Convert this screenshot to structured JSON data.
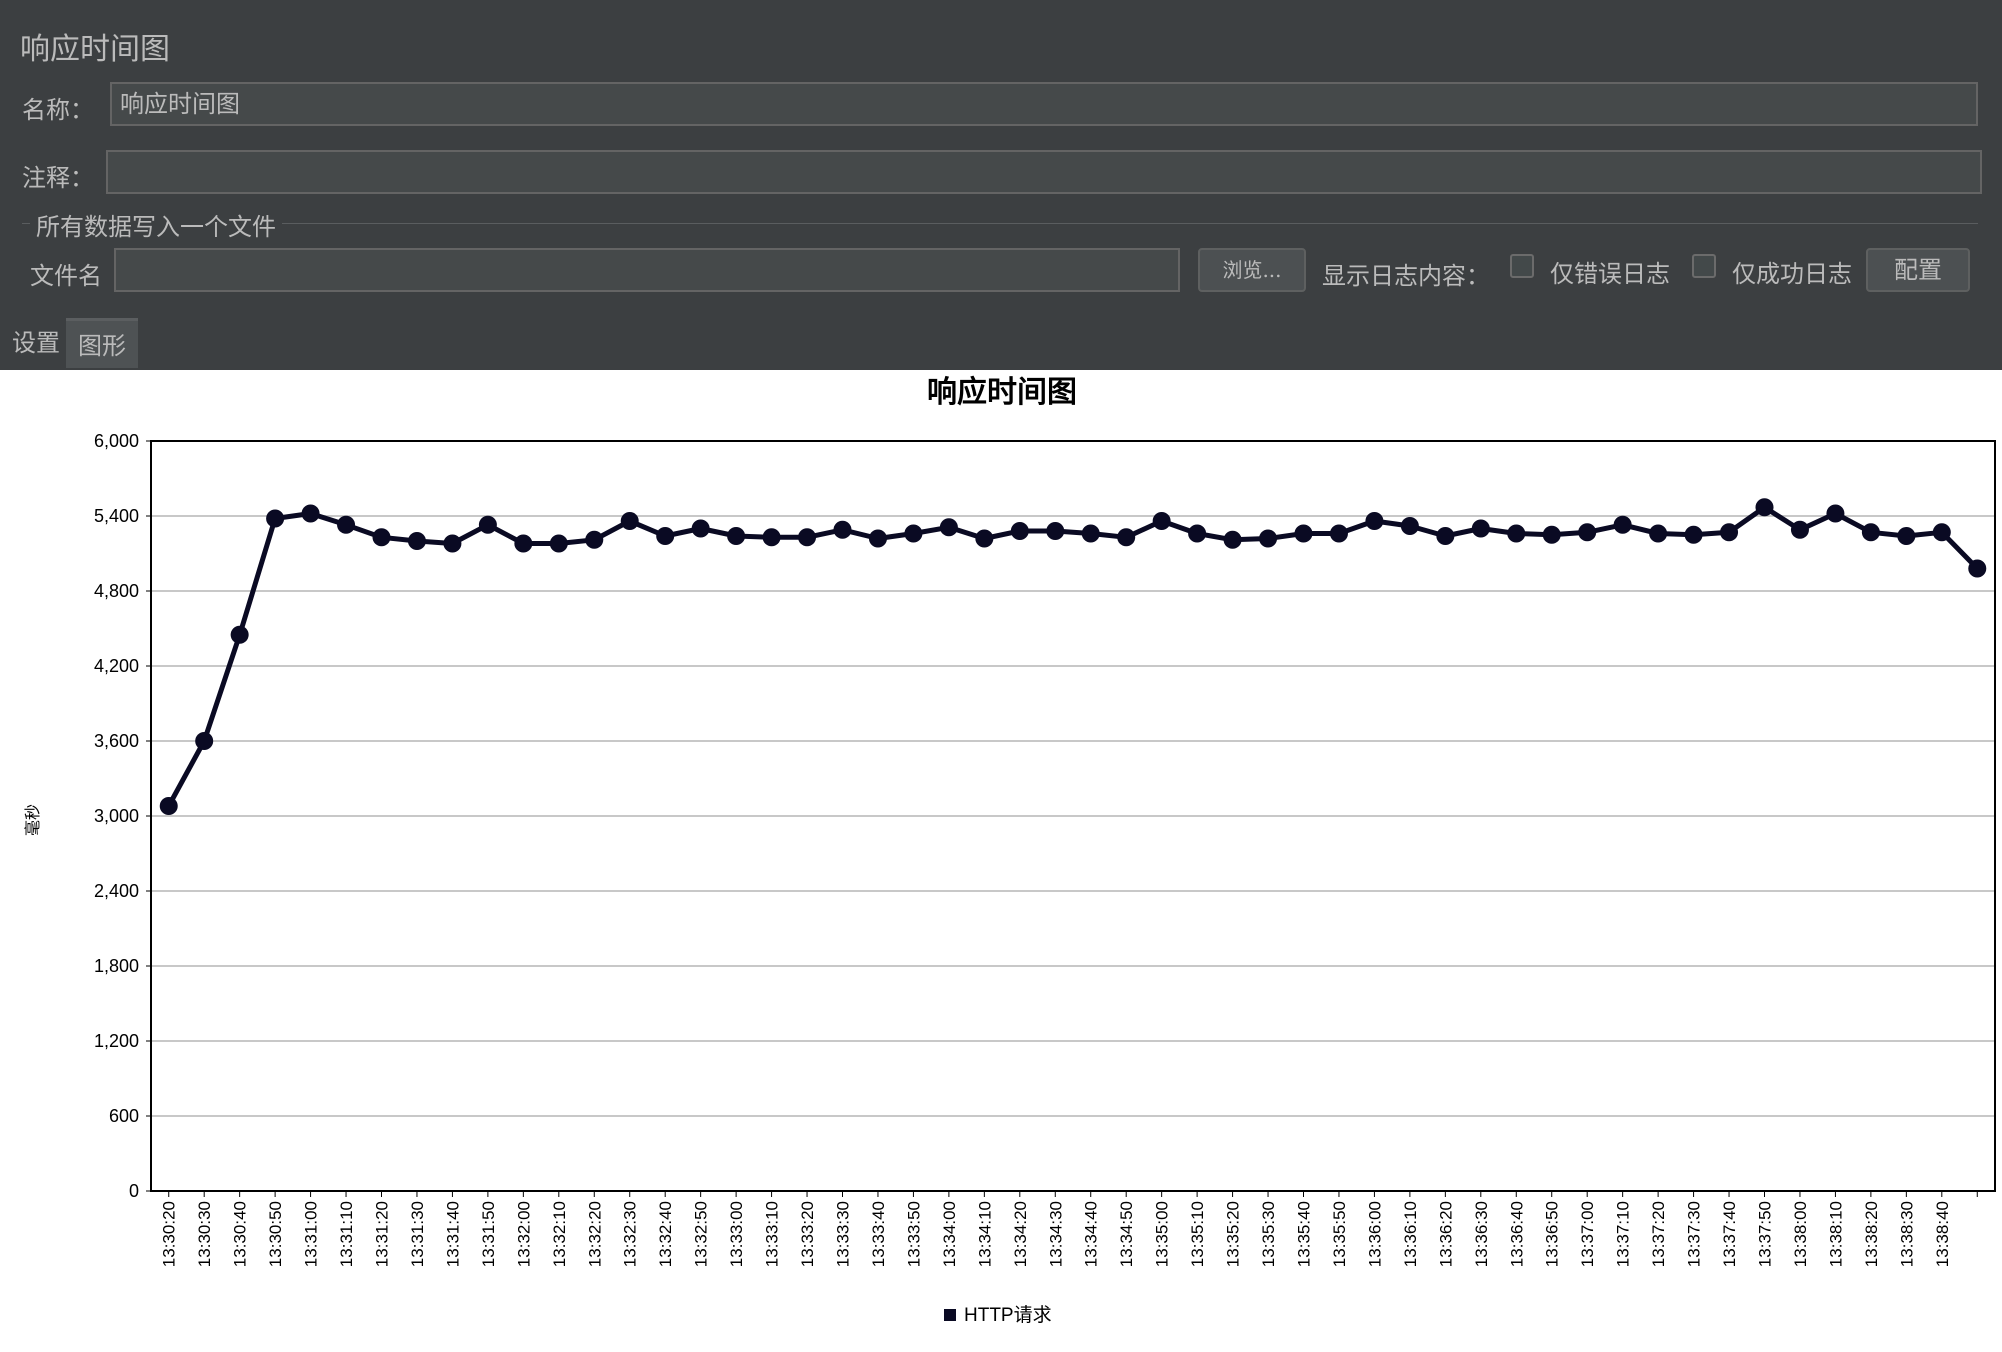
{
  "panel": {
    "title": "响应时间图",
    "name_label": "名称：",
    "name_value": "响应时间图",
    "comment_label": "注释：",
    "comment_value": "",
    "file_section_title": "所有数据写入一个文件",
    "file_label": "文件名",
    "file_value": "",
    "browse_button": "浏览...",
    "log_content_label": "显示日志内容：",
    "errors_only_label": "仅错误日志",
    "success_only_label": "仅成功日志",
    "configure_button": "配置"
  },
  "tabs": [
    {
      "label": "设置",
      "active": false
    },
    {
      "label": "图形",
      "active": true
    }
  ],
  "chart_data": {
    "type": "line",
    "title": "响应时间图",
    "xlabel": "",
    "ylabel": "毫秒",
    "ylim": [
      0,
      6000
    ],
    "yticks": [
      "0",
      "600",
      "1,200",
      "1,800",
      "2,400",
      "3,000",
      "3,600",
      "4,200",
      "4,800",
      "5,400",
      "6,000"
    ],
    "grid": true,
    "legend": "bottom",
    "x": [
      "13:30:20",
      "13:30:30",
      "13:30:40",
      "13:30:50",
      "13:31:00",
      "13:31:10",
      "13:31:20",
      "13:31:30",
      "13:31:40",
      "13:31:50",
      "13:32:00",
      "13:32:10",
      "13:32:20",
      "13:32:30",
      "13:32:40",
      "13:32:50",
      "13:33:00",
      "13:33:10",
      "13:33:20",
      "13:33:30",
      "13:33:40",
      "13:33:50",
      "13:34:00",
      "13:34:10",
      "13:34:20",
      "13:34:30",
      "13:34:40",
      "13:34:50",
      "13:35:00",
      "13:35:10",
      "13:35:20",
      "13:35:30",
      "13:35:40",
      "13:35:50",
      "13:36:00",
      "13:36:10",
      "13:36:20",
      "13:36:30",
      "13:36:40",
      "13:36:50",
      "13:37:00",
      "13:37:10",
      "13:37:20",
      "13:37:30",
      "13:37:40",
      "13:37:50",
      "13:38:00",
      "13:38:10",
      "13:38:20",
      "13:38:30",
      "13:38:40",
      ""
    ],
    "series": [
      {
        "name": "HTTP请求",
        "color": "#0a0a23",
        "values": [
          3080,
          3600,
          4450,
          5380,
          5420,
          5330,
          5230,
          5200,
          5180,
          5330,
          5180,
          5180,
          5210,
          5360,
          5240,
          5300,
          5240,
          5230,
          5230,
          5290,
          5220,
          5260,
          5310,
          5220,
          5280,
          5280,
          5260,
          5230,
          5360,
          5260,
          5210,
          5220,
          5260,
          5260,
          5360,
          5320,
          5240,
          5300,
          5260,
          5250,
          5270,
          5330,
          5260,
          5250,
          5270,
          5470,
          5290,
          5420,
          5270,
          5240,
          5270,
          4980
        ]
      }
    ]
  }
}
